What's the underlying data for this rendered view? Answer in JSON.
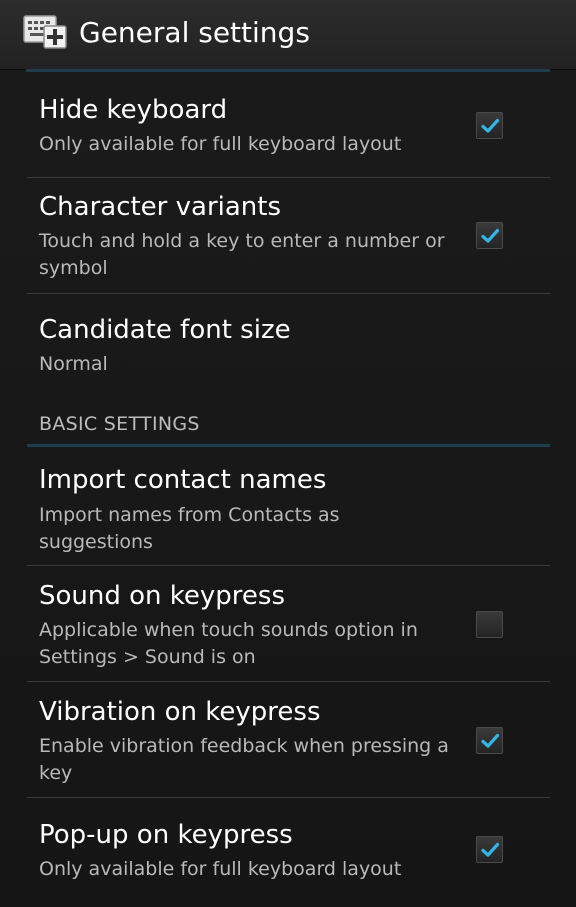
{
  "app_bar": {
    "title": "General settings",
    "icon": "keyboard-settings-icon"
  },
  "colors": {
    "accent": "#33b5e5",
    "divider": "#3a3a3a",
    "summary_text": "#b9b9b9"
  },
  "settings": {
    "hide_keyboard": {
      "title": "Hide keyboard",
      "summary": "Only available for full keyboard layout",
      "checked": true
    },
    "character_variants": {
      "title": "Character variants",
      "summary": "Touch and hold a key to enter a number or symbol",
      "checked": true
    },
    "candidate_font_size": {
      "title": "Candidate font size",
      "summary": "Normal"
    }
  },
  "basic_settings": {
    "header": "BASIC SETTINGS",
    "import_contact_names": {
      "title": "Import contact names",
      "summary": "Import names from Contacts as suggestions"
    },
    "sound_on_keypress": {
      "title": "Sound on keypress",
      "summary": "Applicable when touch sounds option in Settings > Sound is on",
      "checked": false
    },
    "vibration_on_keypress": {
      "title": "Vibration on keypress",
      "summary": "Enable vibration feedback when pressing a key",
      "checked": true
    },
    "popup_on_keypress": {
      "title": "Pop-up on keypress",
      "summary": "Only available for full keyboard layout",
      "checked": true
    }
  }
}
